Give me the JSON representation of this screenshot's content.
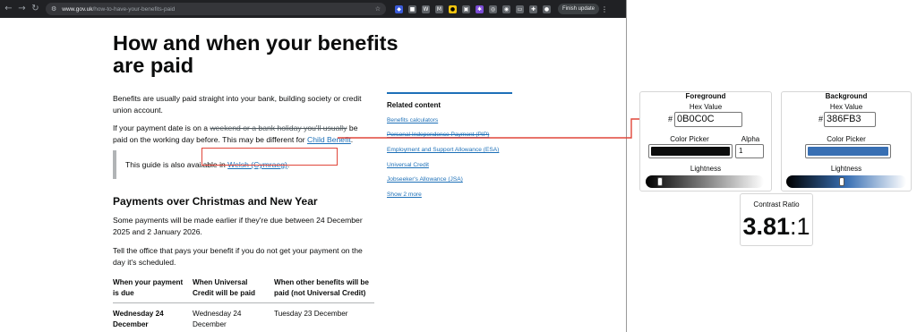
{
  "browser": {
    "url_host": "www.gov.uk",
    "url_path": "/how-to-have-your-benefits-paid",
    "finish_update_label": "Finish update"
  },
  "page": {
    "title": "How and when your benefits are paid",
    "intro": "Benefits are usually paid straight into your bank, building society or credit union account.",
    "holiday_text_1": "If your payment date is on a ",
    "holiday_strike": "weekend or a bank holiday you'll usually",
    "holiday_text_2": " be paid on the working day before.",
    "holiday_text_3": " This may be different for ",
    "child_benefit_link": "Child Benefit",
    "holiday_text_4": ".",
    "welsh_text": "This guide is also available in ",
    "welsh_link": "Welsh (Cymraeg)",
    "welsh_end": ".",
    "section_title": "Payments over Christmas and New Year",
    "section_p1": "Some payments will be made earlier if they're due between 24 December 2025 and 2 January 2026.",
    "section_p2": "Tell the office that pays your benefit if you do not get your payment on the day it's scheduled.",
    "table": {
      "headers": [
        "When your payment is due",
        "When Universal Credit will be paid",
        "When other benefits will be paid (not Universal Credit)"
      ],
      "rows": [
        [
          "Wednesday 24 December",
          "Wednesday 24 December",
          "Tuesday 23 December"
        ]
      ]
    }
  },
  "related": {
    "title": "Related content",
    "links": [
      "Benefits calculators",
      "Personal Independence Payment (PIP)",
      "Employment and Support Allowance (ESA)",
      "Universal Credit",
      "Jobseeker's Allowance (JSA)",
      "Show 2 more"
    ]
  },
  "foreground": {
    "legend": "Foreground",
    "hex_label": "Hex Value",
    "hex_value": "0B0C0C",
    "picker_label": "Color Picker",
    "alpha_label": "Alpha",
    "alpha_value": "1",
    "lightness_label": "Lightness",
    "color": "#0b0c0c",
    "lightness": 0.05
  },
  "background": {
    "legend": "Background",
    "hex_label": "Hex Value",
    "hex_value": "386FB3",
    "picker_label": "Color Picker",
    "lightness_label": "Lightness",
    "color": "#386fb3",
    "lightness": 0.46
  },
  "contrast": {
    "title": "Contrast Ratio",
    "value": "3.81",
    "separator": ":",
    "denominator": "1"
  },
  "colors": {
    "govuk_link": "#1d70b8",
    "annotation_red": "#e0463a"
  }
}
